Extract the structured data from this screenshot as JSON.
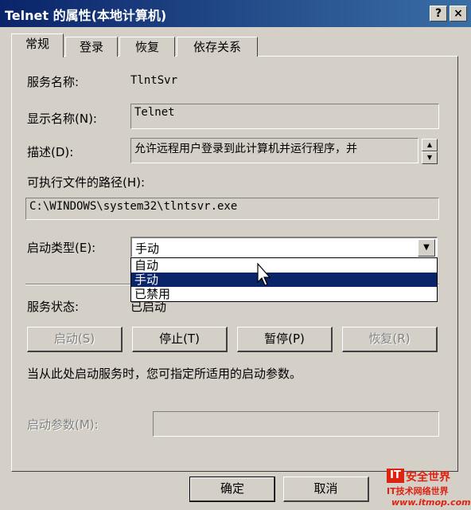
{
  "window": {
    "title": "Telnet 的属性(本地计算机)",
    "help_button": "?",
    "close_button": "×"
  },
  "tabs": [
    {
      "label": "常规",
      "active": true
    },
    {
      "label": "登录",
      "active": false
    },
    {
      "label": "恢复",
      "active": false
    },
    {
      "label": "依存关系",
      "active": false
    }
  ],
  "general": {
    "service_name_label": "服务名称:",
    "service_name_value": "TlntSvr",
    "display_name_label": "显示名称(N):",
    "display_name_value": "Telnet",
    "description_label": "描述(D):",
    "description_value": "允许远程用户登录到此计算机并运行程序，并",
    "exe_path_label": "可执行文件的路径(H):",
    "exe_path_value": "C:\\WINDOWS\\system32\\tlntsvr.exe",
    "startup_type_label": "启动类型(E):",
    "startup_type_value": "手动",
    "startup_options": [
      "自动",
      "手动",
      "已禁用"
    ],
    "startup_selected_index": 1,
    "service_status_label": "服务状态:",
    "service_status_value": "已启动",
    "buttons": {
      "start": "启动(S)",
      "stop": "停止(T)",
      "pause": "暂停(P)",
      "resume": "恢复(R)"
    },
    "hint_text": "当从此处启动服务时，您可指定所适用的启动参数。",
    "start_params_label": "启动参数(M):",
    "start_params_value": ""
  },
  "footer": {
    "ok": "确定",
    "cancel": "取消"
  },
  "watermark": {
    "logo": "IT",
    "title": "安全世界",
    "subtitle": "IT技术网络世界",
    "url": "www.itmop.com"
  },
  "colors": {
    "title_bar_start": "#0a246a",
    "title_bar_end": "#3a6ea5",
    "face": "#d4d0c8",
    "selection": "#0a246a",
    "watermark": "#dd2211"
  }
}
